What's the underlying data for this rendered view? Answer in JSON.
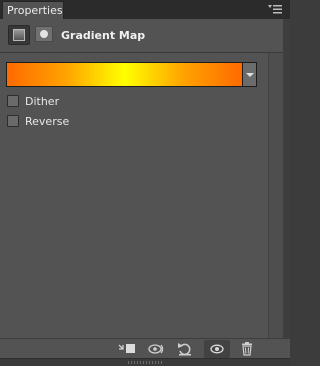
{
  "tab": {
    "label": "Properties"
  },
  "header": {
    "title": "Gradient Map",
    "adjustment_icon": "gradient-map-adjustment-icon",
    "mask_icon": "layer-mask-icon"
  },
  "gradient": {
    "colors": [
      "#ff6a00",
      "#ffa300",
      "#ffff00",
      "#ffa300",
      "#ff6a00"
    ]
  },
  "options": [
    {
      "label": "Dither",
      "checked": false
    },
    {
      "label": "Reverse",
      "checked": false
    }
  ],
  "footer": {
    "buttons": [
      {
        "icon": "clip-to-layer-icon"
      },
      {
        "icon": "view-previous-state-icon"
      },
      {
        "icon": "reset-adjustment-icon"
      },
      {
        "icon": "toggle-visibility-icon",
        "active": true
      },
      {
        "icon": "trash-icon"
      }
    ]
  }
}
